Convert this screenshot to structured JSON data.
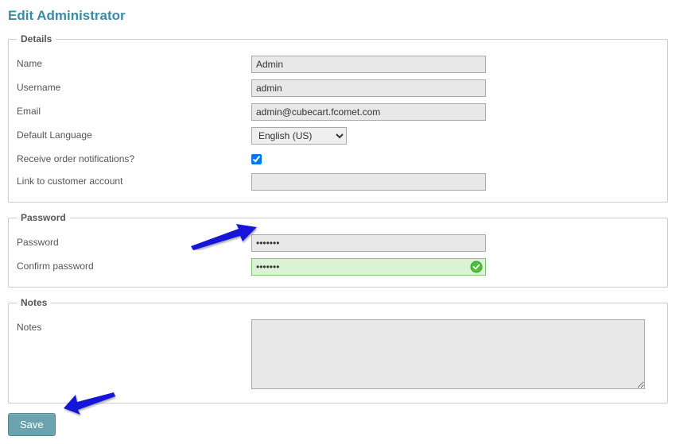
{
  "page": {
    "title": "Edit Administrator"
  },
  "details": {
    "legend": "Details",
    "name_label": "Name",
    "name_value": "Admin",
    "username_label": "Username",
    "username_value": "admin",
    "email_label": "Email",
    "email_value": "admin@cubecart.fcomet.com",
    "language_label": "Default Language",
    "language_value": "English (US)",
    "notifications_label": "Receive order notifications?",
    "notifications_checked": true,
    "customer_link_label": "Link to customer account",
    "customer_link_value": ""
  },
  "password": {
    "legend": "Password",
    "password_label": "Password",
    "password_value": "•••••••",
    "confirm_label": "Confirm password",
    "confirm_value": "•••••••"
  },
  "notes": {
    "legend": "Notes",
    "notes_label": "Notes",
    "notes_value": ""
  },
  "actions": {
    "save_label": "Save"
  }
}
